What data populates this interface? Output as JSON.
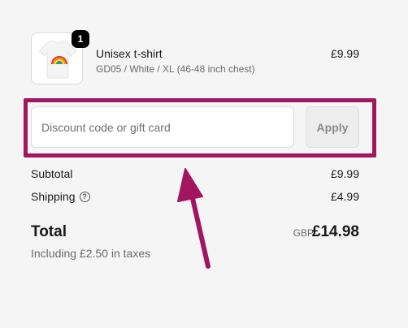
{
  "product": {
    "quantity": "1",
    "name": "Unisex t-shirt",
    "variant": "GD05 / White / XL (46-48 inch chest)",
    "price": "£9.99",
    "image_icon": "tshirt-rainbow-icon"
  },
  "discount": {
    "placeholder": "Discount code or gift card",
    "value": "",
    "apply_label": "Apply"
  },
  "summary": {
    "subtotal_label": "Subtotal",
    "subtotal_value": "£9.99",
    "shipping_label": "Shipping",
    "shipping_help_icon": "question-circle-icon",
    "shipping_value": "£4.99",
    "total_label": "Total",
    "total_currency": "GBP",
    "total_value": "£14.98",
    "tax_note": "Including £2.50 in taxes"
  },
  "annotation": {
    "highlight_color": "#a0175f",
    "arrow_color": "#a0175f"
  }
}
